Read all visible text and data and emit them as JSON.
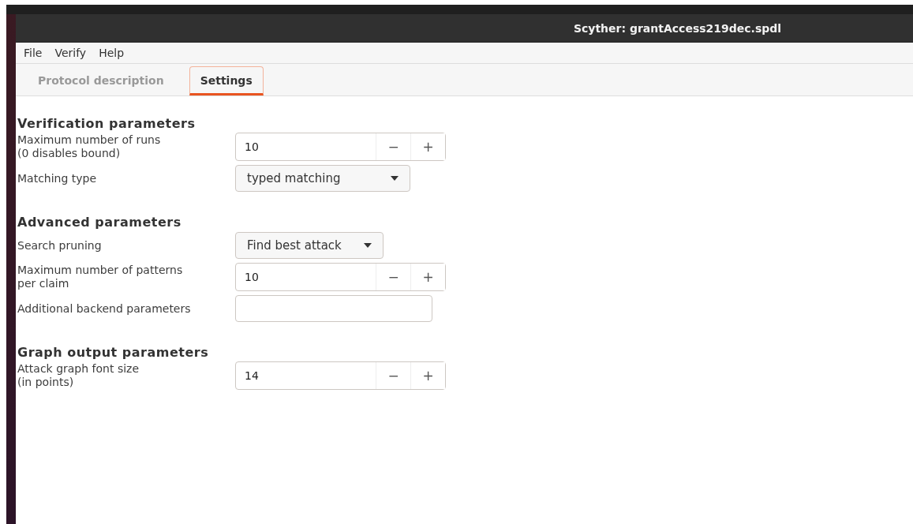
{
  "window": {
    "title": "Scyther: grantAccess219dec.spdl"
  },
  "menu": [
    "File",
    "Verify",
    "Help"
  ],
  "tabs": [
    {
      "label": "Protocol description",
      "selected": false
    },
    {
      "label": "Settings",
      "selected": true
    }
  ],
  "sections": [
    {
      "title": "Verification parameters",
      "rows": [
        {
          "kind": "spin",
          "label": "Maximum number of runs\n(0 disables bound)",
          "value": "10",
          "minus": "−",
          "plus": "+"
        },
        {
          "kind": "combo",
          "label": "Matching type",
          "value": "typed matching"
        }
      ]
    },
    {
      "title": "Advanced parameters",
      "rows": [
        {
          "kind": "combo",
          "label": "Search pruning",
          "value": "Find best attack"
        },
        {
          "kind": "spin",
          "label": "Maximum number of patterns\nper claim",
          "value": "10",
          "minus": "−",
          "plus": "+"
        },
        {
          "kind": "entry",
          "label": "Additional backend parameters"
        }
      ]
    },
    {
      "title": "Graph output parameters",
      "rows": [
        {
          "kind": "spin",
          "label": "Attack graph font size\n(in points)",
          "value": "14",
          "minus": "−",
          "plus": "+"
        }
      ]
    }
  ]
}
